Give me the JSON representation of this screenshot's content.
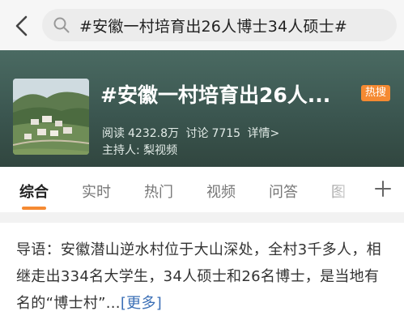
{
  "search": {
    "query": "#安徽一村培育出26人博士34人硕士#"
  },
  "topic": {
    "title": "#安徽一村培育出26人...",
    "badge": "热搜",
    "reads_label": "阅读",
    "reads_value": "4232.8万",
    "discussion_label": "讨论",
    "discussion_value": "7715",
    "details_label": "详情>",
    "host_label": "主持人:",
    "host_name": "梨视频"
  },
  "tabs": [
    {
      "label": "综合",
      "active": true
    },
    {
      "label": "实时",
      "active": false
    },
    {
      "label": "热门",
      "active": false
    },
    {
      "label": "视频",
      "active": false
    },
    {
      "label": "问答",
      "active": false
    },
    {
      "label": "图",
      "active": false
    }
  ],
  "lead": {
    "text": "导语：安徽潜山逆水村位于大山深处，全村3千多人，相继走出334名大学生，34人硕士和26名博士，是当地有名的“博士村”...",
    "more_label": "[更多]"
  },
  "icons": {
    "back": "chevron-left-icon",
    "search": "search-icon",
    "add_tab": "plus-icon"
  },
  "colors": {
    "accent": "#f58a32",
    "link": "#3b6fb6",
    "header_bg": "#3b5650"
  }
}
